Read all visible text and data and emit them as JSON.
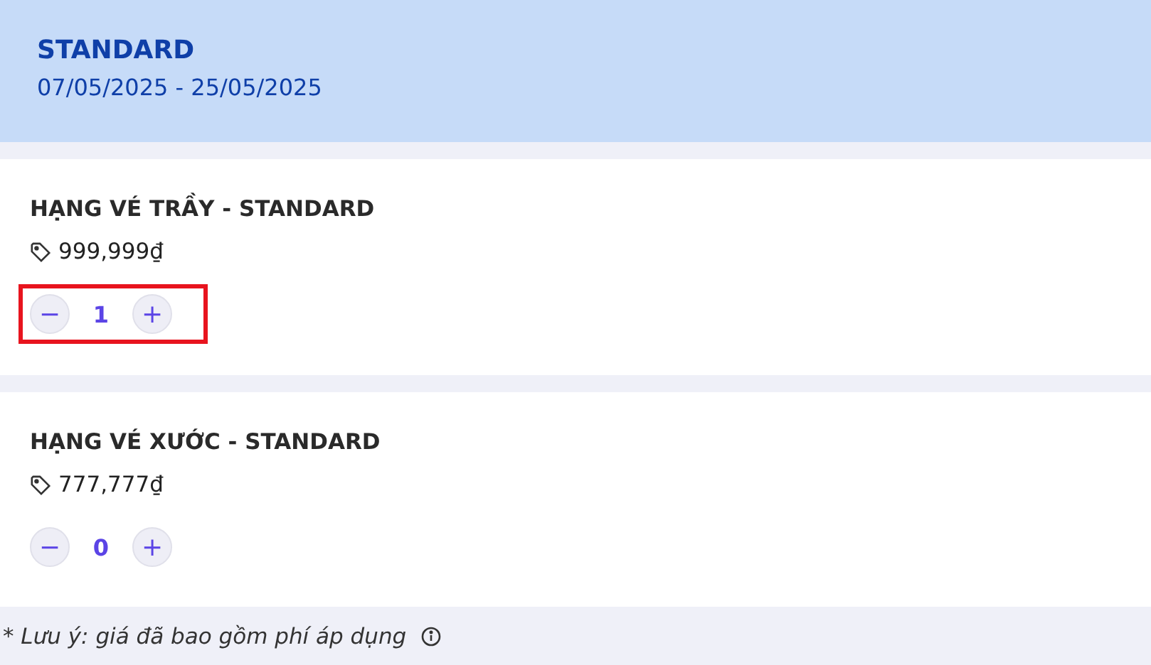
{
  "header": {
    "title": "STANDARD",
    "dates": "07/05/2025 - 25/05/2025"
  },
  "tickets": [
    {
      "name": "HẠNG VÉ TRẦY - STANDARD",
      "price": "999,999₫",
      "minus": "−",
      "quantity": "1",
      "plus": "+",
      "highlighted": true
    },
    {
      "name": "HẠNG VÉ XƯỚC - STANDARD",
      "price": "777,777₫",
      "minus": "−",
      "quantity": "0",
      "plus": "+",
      "highlighted": false
    }
  ],
  "note": "* Lưu ý: giá đã bao gồm phí áp dụng"
}
